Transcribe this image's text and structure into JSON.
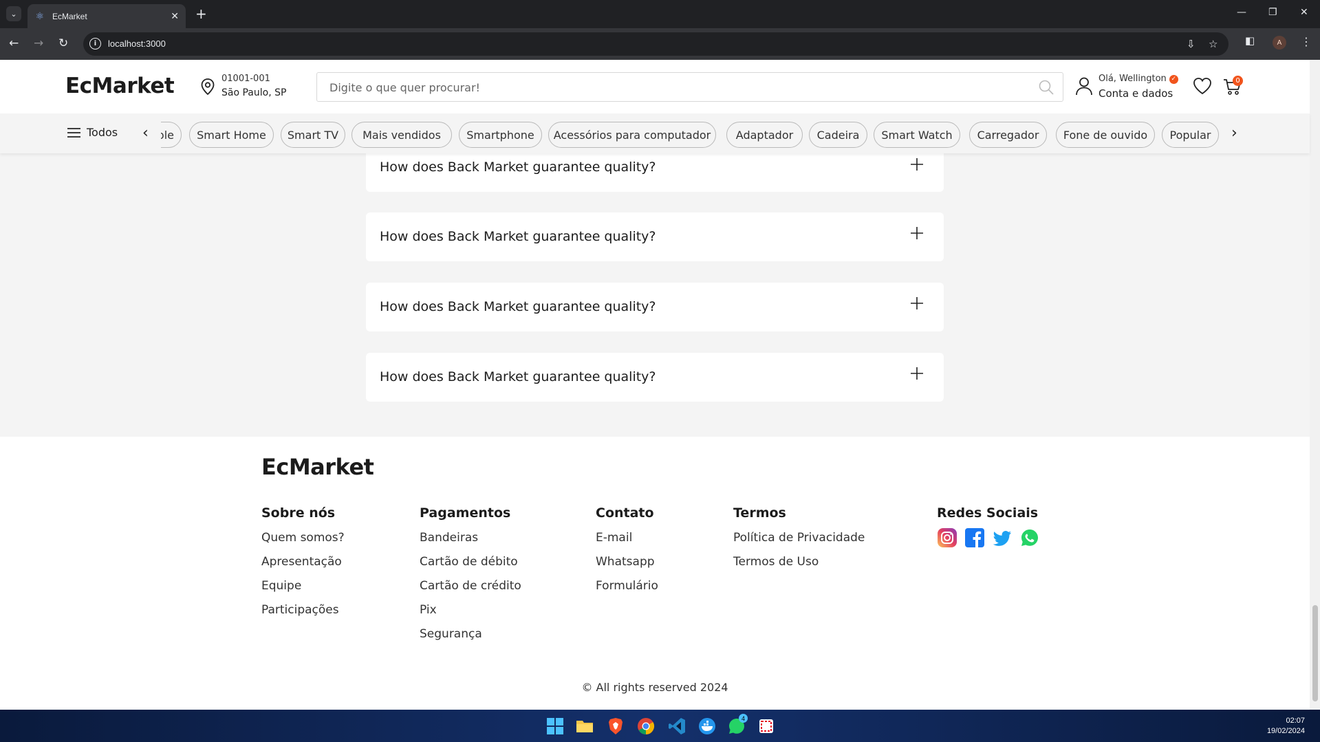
{
  "browser": {
    "tab_title": "EcMarket",
    "url": "localhost:3000",
    "profile_initial": "A"
  },
  "header": {
    "logo": "EcMarket",
    "location": {
      "cep": "01001-001",
      "city": "São Paulo, SP"
    },
    "search_placeholder": "Digite o que quer procurar!",
    "user_greeting": "Olá, Wellington",
    "account_label": "Conta e dados",
    "cart_count": "0"
  },
  "categories": {
    "all_label": "Todos",
    "partial_chip": "ole",
    "items": [
      "Smart Home",
      "Smart TV",
      "Mais vendidos",
      "Smartphone",
      "Acessórios para computador",
      "Adaptador",
      "Cadeira",
      "Smart Watch",
      "Carregador",
      "Fone de ouvido",
      "Popular"
    ]
  },
  "faq": [
    {
      "question": "How does Back Market guarantee quality?"
    },
    {
      "question": "How does Back Market guarantee quality?"
    },
    {
      "question": "How does Back Market guarantee quality?"
    },
    {
      "question": "How does Back Market guarantee quality?"
    }
  ],
  "footer": {
    "logo": "EcMarket",
    "columns": [
      {
        "title": "Sobre nós",
        "links": [
          "Quem somos?",
          "Apresentação",
          "Equipe",
          "Participações"
        ]
      },
      {
        "title": "Pagamentos",
        "links": [
          "Bandeiras",
          "Cartão de débito",
          "Cartão de crédito",
          "Pix",
          "Segurança"
        ]
      },
      {
        "title": "Contato",
        "links": [
          "E-mail",
          "Whatsapp",
          "Formulário"
        ]
      },
      {
        "title": "Termos",
        "links": [
          "Política de Privacidade",
          "Termos de Uso"
        ]
      }
    ],
    "social_title": "Redes Sociais",
    "social_icons": [
      "instagram-icon",
      "facebook-icon",
      "twitter-icon",
      "whatsapp-icon"
    ],
    "copyright": "© All rights reserved 2024"
  },
  "taskbar": {
    "time": "02:07",
    "date": "19/02/2024",
    "whatsapp_badge": "4"
  },
  "colors": {
    "accent": "#f1541c",
    "page_bg": "#f4f4f4"
  }
}
